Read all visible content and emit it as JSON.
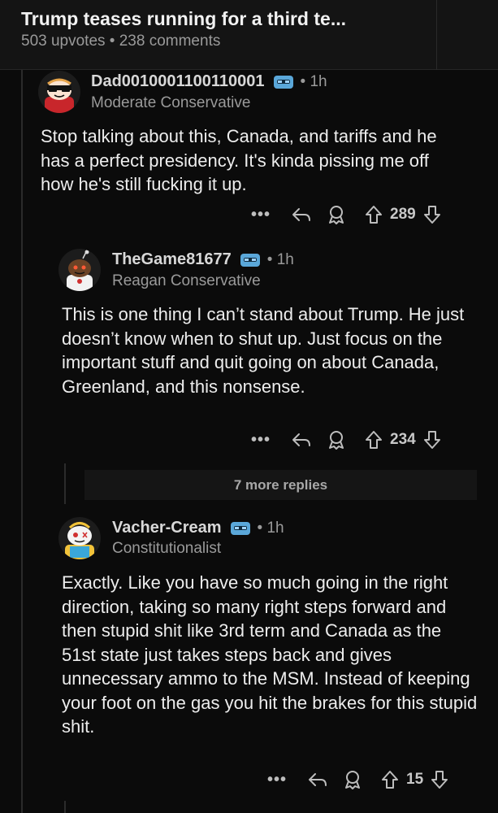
{
  "header": {
    "title": "Trump teases running for a third te...",
    "meta": "503 upvotes • 238 comments"
  },
  "comments": [
    {
      "username": "Dad0010001100110001",
      "time": "• 1h",
      "flair": "Moderate Conservative",
      "body": "Stop talking about this, Canada, and tariffs and he has a perfect presidency. It's kinda pissing me off how he's still fucking it up.",
      "votes": "289"
    },
    {
      "username": "TheGame81677",
      "time": "• 1h",
      "flair": "Reagan Conservative",
      "body": "This is one thing I can’t stand about Trump. He just doesn’t know when to shut up. Just focus on the important stuff and quit going on about Canada, Greenland, and this nonsense.",
      "votes": "234"
    },
    {
      "username": "Vacher-Cream",
      "time": "• 1h",
      "flair": "Constitutionalist",
      "body": "Exactly. Like you have so much going in the right direction, taking so many right steps forward and then stupid shit like 3rd term and Canada as the 51st state just takes steps back and gives unnecessary ammo to the MSM. Instead of keeping your foot on the gas you hit the brakes for this stupid shit.",
      "votes": "15"
    }
  ],
  "more_replies": "7 more replies",
  "actions": {
    "more": "•••"
  },
  "icons": {
    "flair": "flair-badge-icon",
    "reply": "reply-icon",
    "award": "award-icon",
    "upvote": "upvote-arrow-icon",
    "downvote": "downvote-arrow-icon"
  },
  "colors": {
    "background": "#0b0b0b",
    "header": "#141414",
    "flair_badge": "#5aa7d9"
  }
}
